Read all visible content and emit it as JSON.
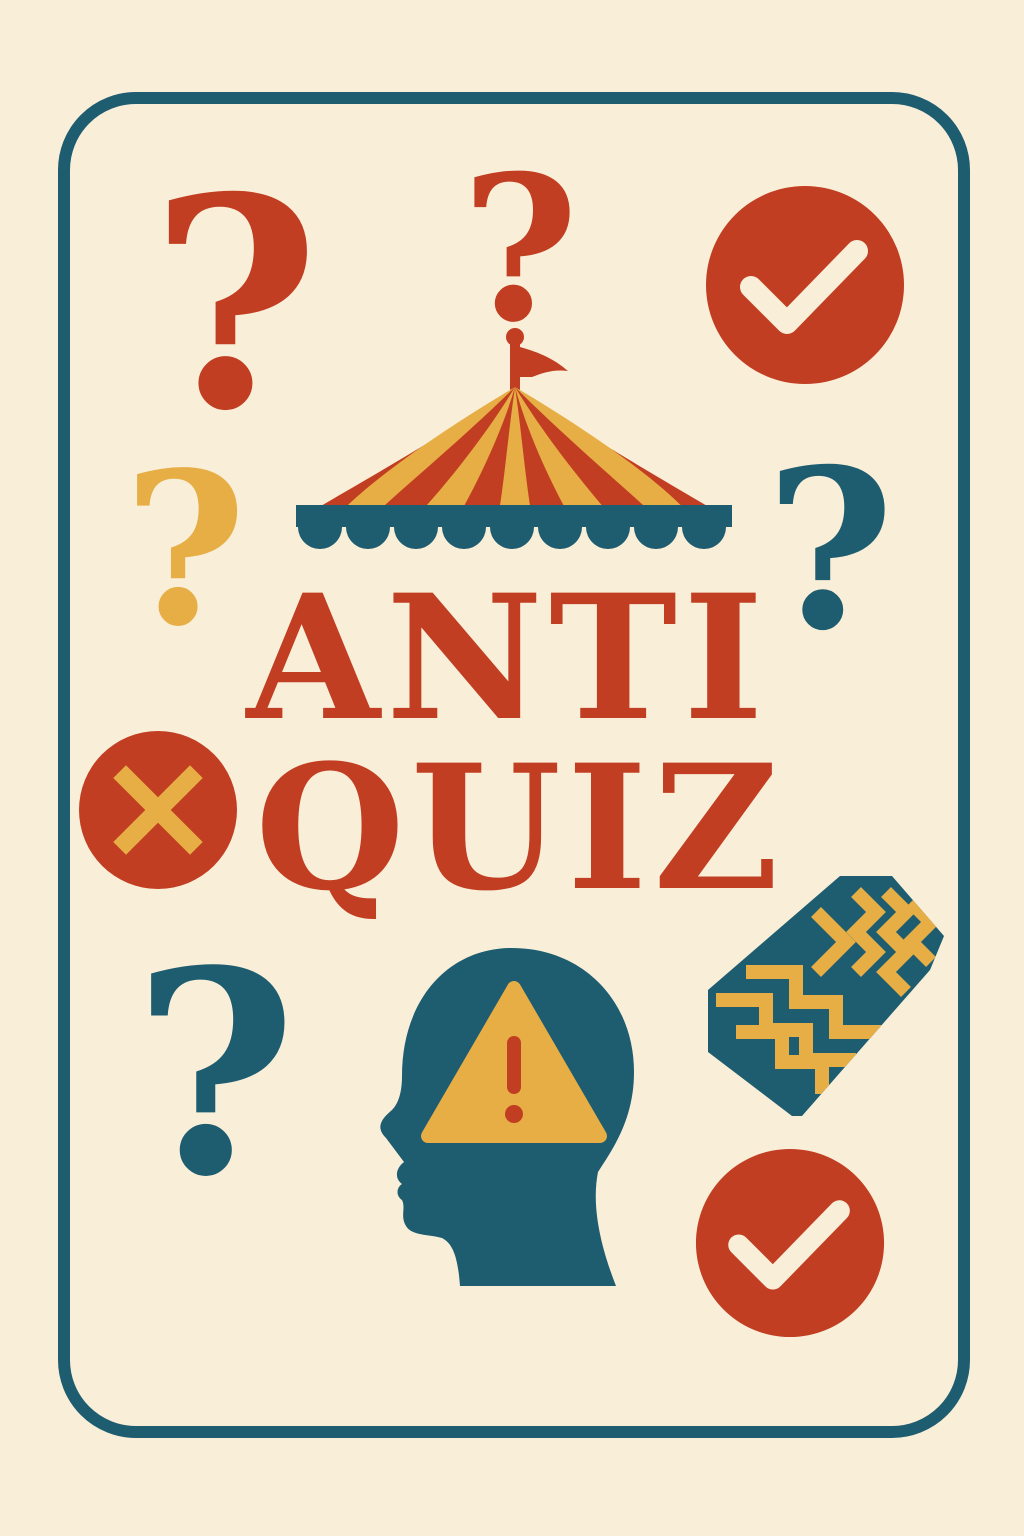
{
  "title": {
    "line1": "ANTI",
    "line2": "QUIZ"
  },
  "question_mark_glyph": "?",
  "icons": [
    "question-mark-icon",
    "check-circle-icon",
    "x-circle-icon",
    "circus-tent-icon",
    "head-warning-icon",
    "striped-block-icon"
  ],
  "colors": {
    "background": "#f9efd9",
    "frame": "#1e5c70",
    "red": "#c23e22",
    "yellow": "#e7ae45",
    "teal": "#1e5c70",
    "cream": "#f9efd9"
  }
}
